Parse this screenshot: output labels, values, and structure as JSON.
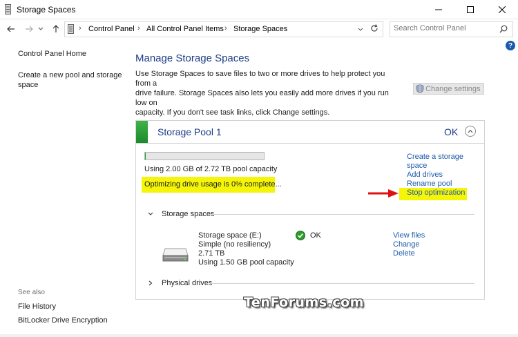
{
  "window": {
    "title": "Storage Spaces"
  },
  "breadcrumb": [
    "Control Panel",
    "All Control Panel Items",
    "Storage Spaces"
  ],
  "search": {
    "placeholder": "Search Control Panel"
  },
  "sidebar": {
    "home": "Control Panel Home",
    "create_pool_line1": "Create a new pool and storage",
    "create_pool_line2": "space",
    "see_also": "See also",
    "file_history": "File History",
    "bitlocker": "BitLocker Drive Encryption"
  },
  "main": {
    "title": "Manage Storage Spaces",
    "intro_line1": "Use Storage Spaces to save files to two or more drives to help protect you from a",
    "intro_line2": "drive failure. Storage Spaces also lets you easily add more drives if you run low on",
    "intro_line3": "capacity. If you don't see task links, click Change settings.",
    "change_settings": "Change settings"
  },
  "pool": {
    "name": "Storage Pool 1",
    "status": "OK",
    "usage": "Using 2.00 GB of 2.72 TB pool capacity",
    "usage_fraction": 0.0007,
    "optimizing": "Optimizing drive usage is 0% complete...",
    "links": {
      "create_line1": "Create a storage",
      "create_line2": "space",
      "add_drives": "Add drives",
      "rename": "Rename pool",
      "stop": "Stop optimization"
    },
    "storage_spaces_label": "Storage spaces",
    "physical_drives_label": "Physical drives",
    "space": {
      "name": "Storage space (E:)",
      "resiliency": "Simple (no resiliency)",
      "size": "2.71 TB",
      "usage": "Using 1.50 GB pool capacity",
      "status": "OK",
      "view_files": "View files",
      "change": "Change",
      "delete": "Delete"
    }
  },
  "watermark": "TenForums.com",
  "colors": {
    "accent": "#1e3d87",
    "link": "#1e5aab",
    "highlight": "#f5f50a",
    "pool_green": "#1d8a2a",
    "arrow": "#e01010"
  }
}
